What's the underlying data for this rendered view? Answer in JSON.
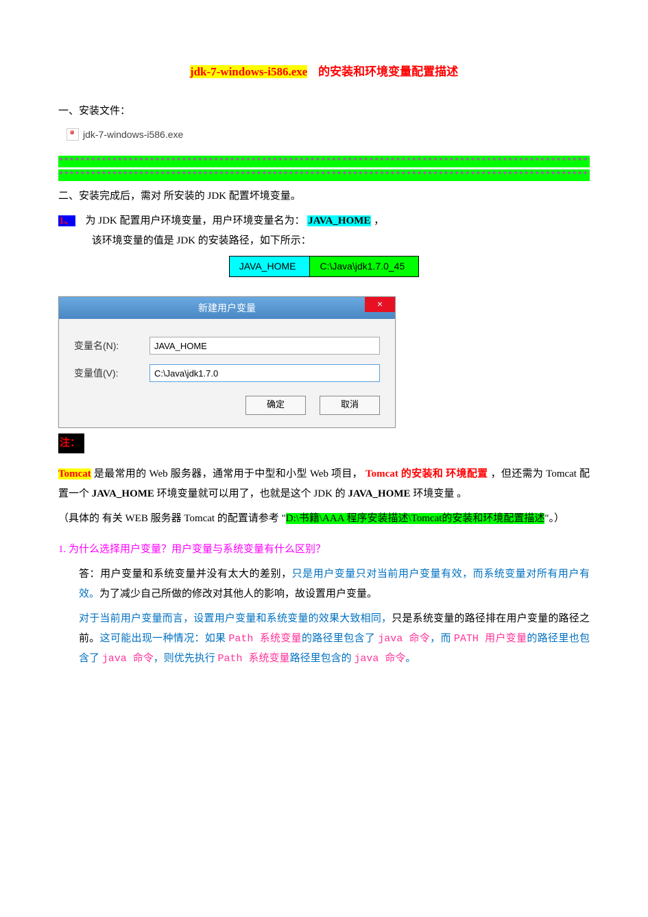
{
  "title": {
    "hl": "jdk-7-windows-i586.exe",
    "rest": "的安装和环境变量配置描述"
  },
  "section1": {
    "heading": "一、安装文件：",
    "file_name": "jdk-7-windows-i586.exe"
  },
  "stripes": {
    "row": "*****************************************************************************************************"
  },
  "section2": {
    "heading": "二、安装完成后，需对 所安装的 JDK 配置坏境变量。",
    "item1": {
      "num": "1、",
      "line1_a": "为 JDK 配置用户环境变量，用户环境变量名为： ",
      "java_home": "JAVA_HOME",
      "line1_b": " ，",
      "line2": "该环境变量的值是   JDK 的安装路径，如下所示："
    },
    "kv": {
      "key": "JAVA_HOME",
      "value": "C:\\Java\\jdk1.7.0_45"
    }
  },
  "dialog": {
    "title": "新建用户变量",
    "close": "×",
    "name_label": "变量名(N):",
    "name_value": "JAVA_HOME",
    "value_label": "变量值(V):",
    "value_value": "C:\\Java\\jdk1.7.0",
    "ok": "确定",
    "cancel": "取消"
  },
  "note": {
    "label": "注：",
    "p1_tomcat": "Tomcat",
    "p1_a": " 是最常用的 Web  服务器，通常用于中型和小型 Web 项目，",
    "p1_b": "Tomcat   的安装和 环境配置",
    "p1_c": "，但还需为 Tomcat 配置一个 ",
    "p1_javahome": "JAVA_HOME",
    "p1_d": " 环境变量就可以用了，也就是这个 JDK 的 ",
    "p1_javahome2": "JAVA_HOME",
    "p1_e": " 环境变量 。",
    "p2_a": "（具体的 有关 WEB  服务器 Tomcat 的配置请参考 \"",
    "p2_path": "D:\\书籍\\AAA  程序安装描述\\Tomcat的安装和环境配置描述",
    "p2_b": "\"。）"
  },
  "qa": {
    "q": "1. 为什么选择用户变量？用户变量与系统变量有什么区别？",
    "a1_a": "答：用户变量和系统变量并没有太大的差别，",
    "a1_b": "只是用户变量只对当前用户变量有效，而系统变量对所有用户有效。",
    "a1_c": "为了减少自己所做的修改对其他人的影响，故设置用户变量。",
    "a2_a": "对于当前用户变量而言，设置用户变量和系统变量的效果大致相同，",
    "a2_b": "只是系统变量的路径排在用户变量的路径之前。",
    "a2_c": "这可能出现一种情况：如果 ",
    "path1": "Path  系统变量",
    "a2_d": "的路径里包含了 ",
    "java1": "java 命令",
    "a2_e": "，而 ",
    "path2": "PATH  用户变量",
    "a2_f": "的路径里也包含了 ",
    "java2": "java 命令",
    "a2_g": "，则优先执行 ",
    "path3": "Path  系统变量",
    "a2_h": "路径里包含的 ",
    "java3": "java 命令",
    "a2_i": "。"
  }
}
